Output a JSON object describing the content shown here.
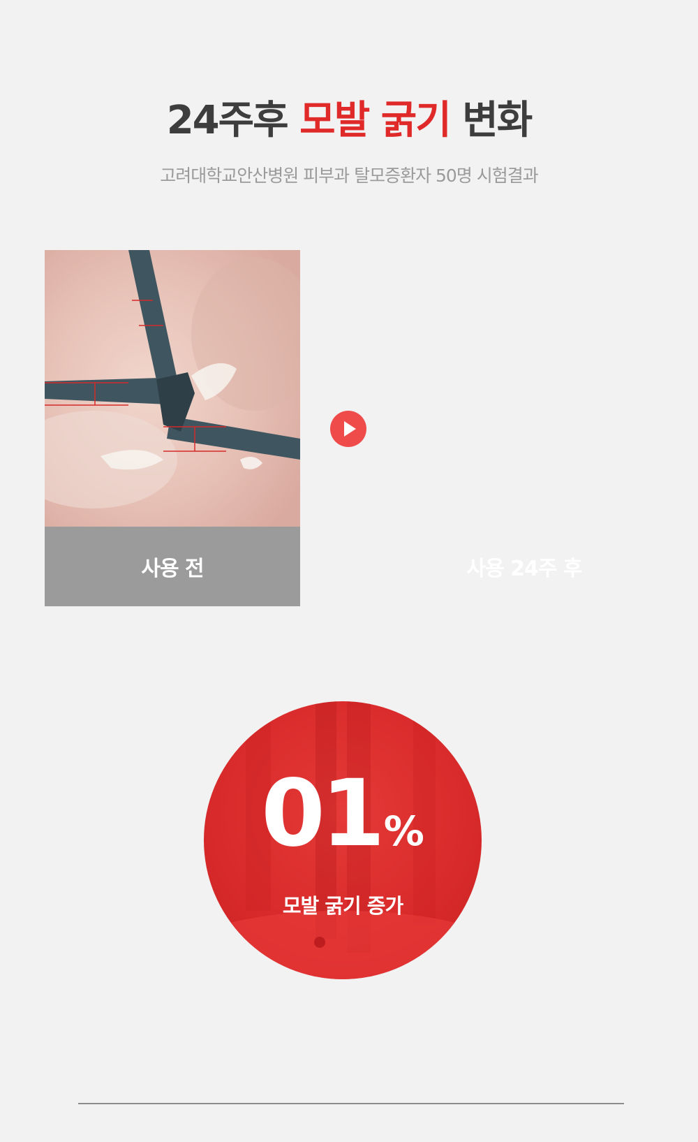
{
  "header": {
    "title_prefix": "24주후",
    "title_highlight": "모발 굵기",
    "title_suffix": "변화",
    "subtitle": "고려대학교안산병원 피부과 탈모증환자 50명 시험결과",
    "highlight_color": "#e02a2a"
  },
  "comparison": {
    "before_label": "사용 전",
    "after_label": "사용 24주 후",
    "play_icon": "play-icon"
  },
  "result": {
    "value": "01",
    "unit": "%",
    "caption": "모발 굵기 증가",
    "circle_color": "#d92b2b"
  }
}
